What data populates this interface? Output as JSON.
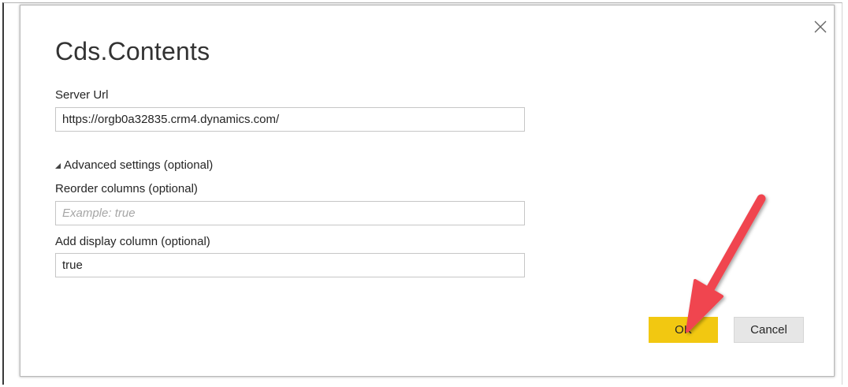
{
  "dialog": {
    "title": "Cds.Contents",
    "server_url": {
      "label": "Server Url",
      "value": "https://orgb0a32835.crm4.dynamics.com/"
    },
    "advanced": {
      "toggle_label": "Advanced settings (optional)",
      "reorder_columns": {
        "label": "Reorder columns (optional)",
        "placeholder": "Example: true",
        "value": ""
      },
      "add_display_column": {
        "label": "Add display column (optional)",
        "value": "true"
      }
    },
    "buttons": {
      "ok_label": "OK",
      "cancel_label": "Cancel"
    }
  },
  "colors": {
    "ok_button": "#f2c811",
    "cancel_button": "#e6e6e6",
    "annotation_arrow": "#f0454f"
  },
  "icons": {
    "close": "close-icon",
    "advanced_toggle": "triangle-expanded-icon"
  }
}
